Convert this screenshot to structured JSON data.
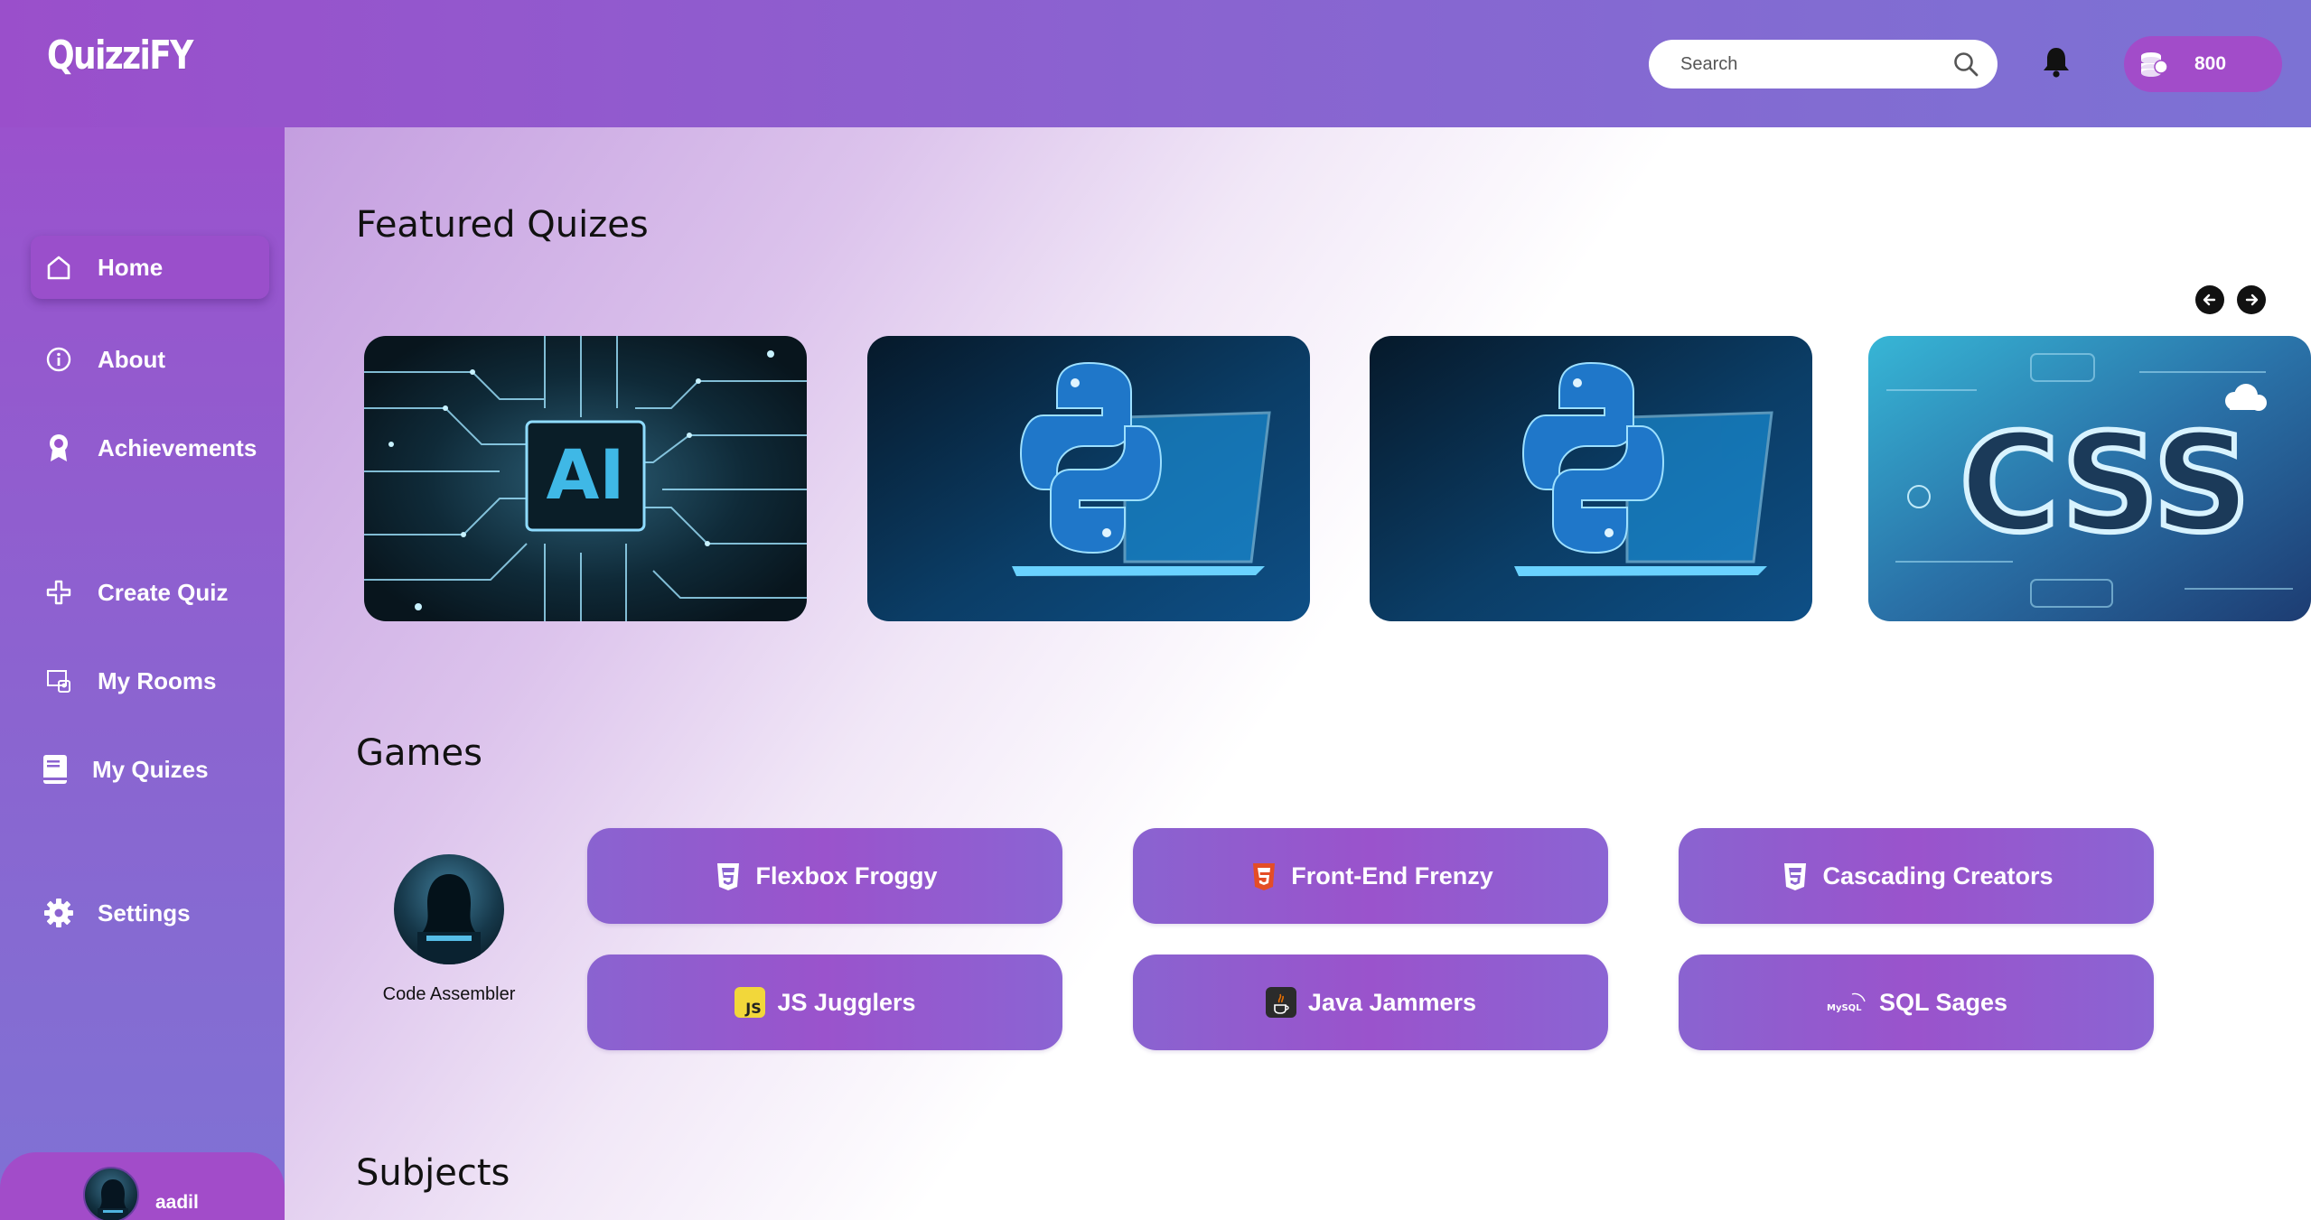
{
  "app": {
    "title": "QuizziFY"
  },
  "header": {
    "search_placeholder": "Search",
    "coins": "800"
  },
  "sidebar": {
    "items": [
      {
        "label": "Home",
        "icon": "home-icon",
        "active": true
      },
      {
        "label": "About",
        "icon": "info-icon"
      },
      {
        "label": "Achievements",
        "icon": "award-icon"
      },
      {
        "label": "Create Quiz",
        "icon": "plus-icon"
      },
      {
        "label": "My Rooms",
        "icon": "rooms-icon"
      },
      {
        "label": "My Quizes",
        "icon": "book-icon"
      },
      {
        "label": "Settings",
        "icon": "gear-icon"
      }
    ],
    "user": {
      "name": "aadil"
    }
  },
  "featured": {
    "title": "Featured Quizes",
    "cards": [
      {
        "image": "ai-chip-image"
      },
      {
        "image": "python-laptop-image"
      },
      {
        "image": "python-laptop-image"
      },
      {
        "image": "css-image",
        "text": "CSS"
      }
    ]
  },
  "games": {
    "title": "Games",
    "player": {
      "name": "Code Assembler"
    },
    "buttons": [
      {
        "label": "Flexbox Froggy",
        "icon": "css3-icon"
      },
      {
        "label": "Front-End Frenzy",
        "icon": "html5-icon"
      },
      {
        "label": "Cascading Creators",
        "icon": "css3-icon"
      },
      {
        "label": "JS Jugglers",
        "icon": "js-icon",
        "icon_text": "JS"
      },
      {
        "label": "Java Jammers",
        "icon": "java-icon"
      },
      {
        "label": "SQL Sages",
        "icon": "mysql-icon",
        "icon_text": "MySQL"
      }
    ]
  },
  "subjects": {
    "title": "Subjects"
  },
  "colors": {
    "accent": "#9a4fcb",
    "sidebar_bottom": "#7f72d4",
    "button": "#8a63d0"
  }
}
